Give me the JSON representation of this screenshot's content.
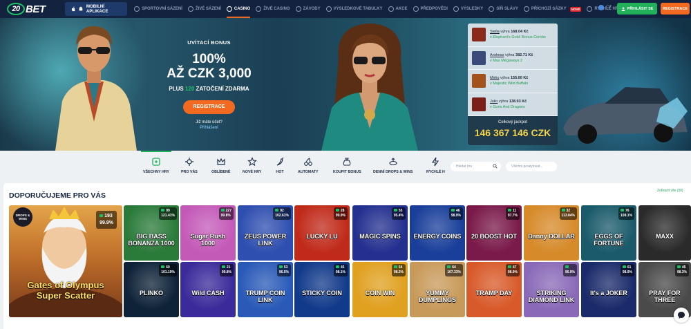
{
  "brand": {
    "logo_text": "20BET"
  },
  "header": {
    "app_button": "MOBILNÍ APLIKACE",
    "nav": [
      {
        "label": "SPORTOVNÍ SÁZENÍ",
        "active": false
      },
      {
        "label": "ŽIVÉ SÁZENÍ",
        "active": false
      },
      {
        "label": "CASINO",
        "active": true
      },
      {
        "label": "ŽIVÉ CASINO",
        "active": false
      },
      {
        "label": "ZÁVODY",
        "active": false
      },
      {
        "label": "VÝSLEDKOVÉ TABULKY",
        "active": false
      },
      {
        "label": "AKCE",
        "active": false
      },
      {
        "label": "PŘEDPOVĚDI",
        "active": false
      },
      {
        "label": "VÝSLEDKY",
        "active": false
      },
      {
        "label": "SÍŇ SLÁVY",
        "active": false
      },
      {
        "label": "PŘÍCHOZÍ SÁZKY",
        "active": false,
        "badge": "NOVÉ"
      },
      {
        "label": "RYCHLÉ HRY",
        "active": false
      }
    ],
    "language": "CZ",
    "login": "PŘIHLÁSIT SE",
    "register": "REGISTRACE"
  },
  "banner": {
    "welcome": "UVÍTACÍ BONUS",
    "percent": "100%",
    "amount": "AŽ CZK 3,000",
    "spins_pre": "PLUS ",
    "spins_num": "120",
    "spins_post": " ZATOČENÍ ZDARMA",
    "cta": "REGISTRACE",
    "have_account": "Již máte účet?",
    "login_link": "Přihlášení"
  },
  "winners": [
    {
      "name": "Stella",
      "won": "výhra",
      "amount": "168.04 Kč",
      "game": "Elephant's Gold: Bonus Combo",
      "color": "#8b2a1a"
    },
    {
      "name": "Andreas",
      "won": "výhra",
      "amount": "382.71 Kč",
      "game": "Max Megaways 2",
      "color": "#3b4a7a"
    },
    {
      "name": "Mirko",
      "won": "výhra",
      "amount": "155.60 Kč",
      "game": "Majestic Wild Buffalo",
      "color": "#a4521c"
    },
    {
      "name": "Julio",
      "won": "výhra",
      "amount": "138.93 Kč",
      "game": "Guns And Dragons",
      "color": "#7a2018"
    }
  ],
  "jackpot": {
    "label": "Celkový jackpot",
    "value": "146 367 146 CZK"
  },
  "categories": [
    {
      "label": "VŠECHNY HRY",
      "active": true,
      "icon": "all-games-icon"
    },
    {
      "label": "PRO VÁS",
      "active": false,
      "icon": "for-you-icon"
    },
    {
      "label": "OBLÍBENÉ",
      "active": false,
      "icon": "crown-icon"
    },
    {
      "label": "NOVÉ HRY",
      "active": false,
      "icon": "star-icon"
    },
    {
      "label": "HOT",
      "active": false,
      "icon": "chili-icon"
    },
    {
      "label": "AUTOMATY",
      "active": false,
      "icon": "cherries-icon"
    },
    {
      "label": "KOUPIT BONUS",
      "active": false,
      "icon": "moneybag-icon"
    },
    {
      "label": "DENNÍ DROPS & WINS",
      "active": false,
      "icon": "drops-icon"
    },
    {
      "label": "RYCHLÉ H",
      "active": false,
      "icon": "lightning-icon"
    }
  ],
  "search": {
    "placeholder": "Hledat hru"
  },
  "providers": {
    "placeholder": "Všichni poskytovat..."
  },
  "section": {
    "title": "DOPORUČUJEME PRO VÁS",
    "show_all": "Zobrazit vše (30)"
  },
  "featured": {
    "name": "Gates of Olympus Super Scatter",
    "drops_badge": "DROPS & WINS",
    "players": "193",
    "rtp": "99.9%"
  },
  "games": [
    {
      "name": "BIG BASS BONANZA 1000",
      "players": "99",
      "rtp": "121.41%",
      "bg": "#2a7a3a"
    },
    {
      "name": "Sugar Rush 1000",
      "players": "227",
      "rtp": "99.8%",
      "bg": "#c45ab8"
    },
    {
      "name": "ZEUS POWER LINK",
      "players": "92",
      "rtp": "102.61%",
      "bg": "#2f4fb0"
    },
    {
      "name": "LUCKY LU",
      "players": "28",
      "rtp": "99.9%",
      "bg": "#c02a1a"
    },
    {
      "name": "MAGIC SPINS",
      "players": "55",
      "rtp": "95.4%",
      "bg": "#23308f"
    },
    {
      "name": "ENERGY COINS",
      "players": "46",
      "rtp": "98.9%",
      "bg": "#1a3f9a"
    },
    {
      "name": "20 BOOST HOT",
      "players": "11",
      "rtp": "97.7%",
      "bg": "#7a1a4a"
    },
    {
      "name": "Danny DOLLAR",
      "players": "32",
      "rtp": "113.84%",
      "bg": "#d68a2a"
    },
    {
      "name": "EGGS OF FORTUNE",
      "players": "76",
      "rtp": "108.1%",
      "bg": "#1a5a6a"
    },
    {
      "name": "MAXX",
      "players": "",
      "rtp": "",
      "bg": "#2a2a2a"
    },
    {
      "name": "PLINKO",
      "players": "60",
      "rtp": "101.19%",
      "bg": "#0e2238"
    },
    {
      "name": "Wild CASH",
      "players": "21",
      "rtp": "99.8%",
      "bg": "#3a2a9a"
    },
    {
      "name": "TRUMP COIN LINK",
      "players": "53",
      "rtp": "96.5%",
      "bg": "#2a5ab8"
    },
    {
      "name": "STICKY COIN",
      "players": "45",
      "rtp": "98.1%",
      "bg": "#123a8a"
    },
    {
      "name": "COIN WIN",
      "players": "54",
      "rtp": "98.2%",
      "bg": "#e0a020"
    },
    {
      "name": "YUMMY DUMPLINGS",
      "players": "64",
      "rtp": "107.33%",
      "bg": "#c89a5a"
    },
    {
      "name": "TRAMP DAY",
      "players": "47",
      "rtp": "98.9%",
      "bg": "#d85a2a"
    },
    {
      "name": "STRIKING DIAMOND LINK",
      "players": "",
      "rtp": "96.9%",
      "bg": "#8a6ab8"
    },
    {
      "name": "It's a JOKER",
      "players": "61",
      "rtp": "98.9%",
      "bg": "#1a2a6a"
    },
    {
      "name": "PRAY FOR THREE",
      "players": "45",
      "rtp": "98.3%",
      "bg": "#4a4a4a"
    }
  ],
  "colors": {
    "nav_bg": "#13233f",
    "accent_orange": "#f26a21",
    "accent_green": "#22b15b",
    "jackpot_gold": "#f3d34a"
  }
}
